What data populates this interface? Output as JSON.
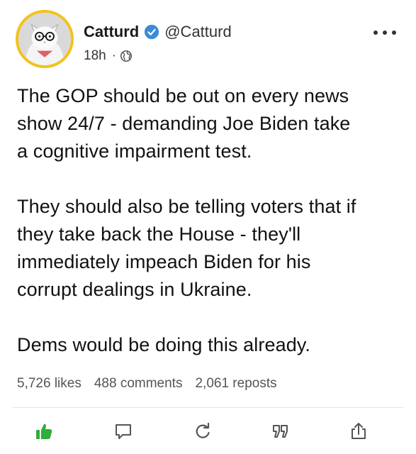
{
  "author": {
    "display_name": "Catturd",
    "handle": "@Catturd",
    "verified": true,
    "avatar": "cat-with-glasses-avatar",
    "avatar_border_color": "#f2c21b"
  },
  "meta": {
    "time": "18h",
    "separator": "·",
    "visibility_icon": "globe-icon"
  },
  "post": {
    "paragraphs": [
      "The GOP should be out on every news\nshow 24/7 - demanding Joe Biden take\na cognitive impairment test.",
      "They should also be telling voters that if\nthey take back the House - they'll\nimmediately impeach Biden for his\ncorrupt dealings in Ukraine.",
      "Dems would be doing this already."
    ]
  },
  "stats": {
    "likes": "5,726 likes",
    "comments": "488 comments",
    "reposts": "2,061 reposts"
  },
  "actions": [
    {
      "name": "like",
      "icon": "thumbs-up-icon",
      "active": true
    },
    {
      "name": "comment",
      "icon": "comment-icon"
    },
    {
      "name": "repost",
      "icon": "repost-icon"
    },
    {
      "name": "quote",
      "icon": "quote-icon"
    },
    {
      "name": "share",
      "icon": "share-icon"
    }
  ],
  "colors": {
    "like_active": "#2fae3a",
    "verified_badge": "#3a8bd8",
    "icon_gray": "#555555"
  }
}
